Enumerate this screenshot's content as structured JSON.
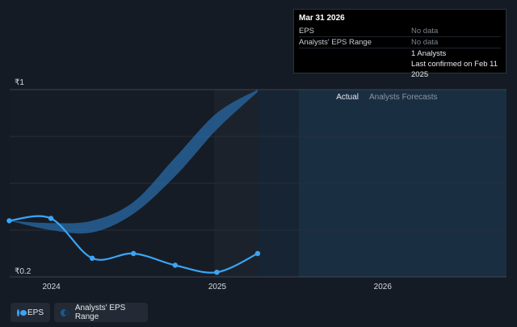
{
  "tooltip": {
    "date": "Mar 31 2026",
    "eps_label": "EPS",
    "eps_value": "No data",
    "range_label": "Analysts' EPS Range",
    "range_value": "No data",
    "analysts": "1 Analysts",
    "confirmed": "Last confirmed on Feb 11 2025"
  },
  "legend": {
    "eps": "EPS",
    "range": "Analysts' EPS Range"
  },
  "colors": {
    "eps_line": "#3aa5f5",
    "range_fill": "#2a6aa6",
    "forecast_bg": "#1a2e42"
  },
  "chart_data": {
    "type": "line",
    "y_axis": {
      "top_label": "₹1",
      "bottom_label": "₹0.2",
      "ylim": [
        0.2,
        1.0
      ]
    },
    "x_axis": {
      "ticks": [
        "2024",
        "2025",
        "2026"
      ]
    },
    "sections": {
      "actual": "Actual",
      "forecast": "Analysts Forecasts"
    },
    "series": [
      {
        "name": "EPS",
        "x": [
          "2023-09-30",
          "2023-12-31",
          "2024-03-31",
          "2024-06-30",
          "2024-09-30",
          "2024-12-31",
          "2025-03-31"
        ],
        "y": [
          0.44,
          0.45,
          0.28,
          0.3,
          0.25,
          0.22,
          0.3
        ]
      },
      {
        "name": "Analysts' EPS Range",
        "x": [
          "2023-09-30",
          "2023-12-31",
          "2024-03-31",
          "2024-06-30",
          "2024-09-30",
          "2024-12-31",
          "2025-03-31"
        ],
        "low": [
          0.44,
          0.4,
          0.39,
          0.47,
          0.63,
          0.83,
          0.99
        ],
        "high": [
          0.44,
          0.43,
          0.44,
          0.52,
          0.71,
          0.9,
          1.0
        ]
      }
    ]
  }
}
